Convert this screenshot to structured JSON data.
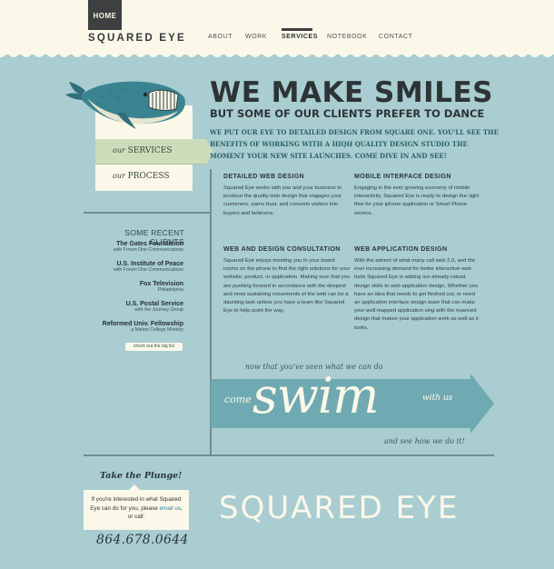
{
  "header": {
    "home_label": "HOME",
    "logo_text": "SQUARED EYE",
    "nav": [
      {
        "label": "ABOUT"
      },
      {
        "label": "WORK"
      },
      {
        "label": "SERVICES"
      },
      {
        "label": "NOTEBOOK"
      },
      {
        "label": "CONTACT"
      }
    ],
    "active_nav": "SERVICES"
  },
  "hero": {
    "title": "WE MAKE SMILES",
    "subtitle": "BUT SOME OF OUR CLIENTS PREFER TO DANCE",
    "intro": "WE PUT OUR EYE TO DETAILED DESIGN FROM SQUARE ONE. YOU'LL SEE THE BENEFITS OF WORKING WITH A HIQH QUALITY DESIGN STUDIO THE MOMENT YOUR NEW SITE LAUNCHES. COME DIVE IN AND SEE!"
  },
  "side_nav": {
    "services_prefix": "our",
    "services_label": "SERVICES",
    "process_prefix": "our",
    "process_label": "PROCESS"
  },
  "clients": {
    "title": "SOME RECENT CLIENTS",
    "items": [
      {
        "name": "The Gates Foundation",
        "sub": "with Forum One Communications"
      },
      {
        "name": "U.S. Institute of Peace",
        "sub": "with Forum One Communications"
      },
      {
        "name": "Fox Television",
        "sub": "Philadelphia"
      },
      {
        "name": "U.S. Postal Service",
        "sub": "with the Journey Group"
      },
      {
        "name": "Reformed Univ. Fellowship",
        "sub": "a Nation College Ministry"
      }
    ],
    "big_list_link": "check out the big list"
  },
  "services": [
    {
      "heading": "DETAILED WEB DESIGN",
      "body": "Squared Eye works with you and your business to produce the quality web design that engages your customers, earns trust, and converts visitors into buyers and believers."
    },
    {
      "heading": "MOBILE INTERFACE DESIGN",
      "body": "Engaging in the ever growing economy of mobile interactivity, Squared Eye is ready to design the right flow for your iphone application or Smart Phone service."
    },
    {
      "heading": "WEB AND DESIGN CONSULTATION",
      "body": "Squared Eye enjoys meeting you in your board rooms on the phone to find the right solutions for your website, product, or application. Making sure that you are pushing forward in accordance with the deepest and most sustaining movements of the web can be a daunting task unless you have a team like Squared Eye to help point the way."
    },
    {
      "heading": "WEB APPLICATION DESIGN",
      "body": "With the advent of what many call web 2.0, and the ever increasing demand for better interactive web tools Squared Eye is adding our already robust design skills to web application design. Whether you have an idea that needs to get fleshed out, or need an application interface design team that can make your well mapped application sing with the nuanced design that makes your application work as well as it looks."
    }
  ],
  "swim": {
    "intro": "now that you've seen what we can do",
    "come": "come",
    "word": "swim",
    "with": "with us",
    "outro": "and see how we do it!"
  },
  "contact": {
    "plunge_title": "Take the Plunge!",
    "text_before": "If you're interested in what Squared Eye can do for you, please",
    "email_link": "email us",
    "text_after": ", or call:",
    "phone": "864.678.0644"
  },
  "footer": {
    "logo_text": "SQUARED EYE"
  },
  "colors": {
    "background": "#a9cdd1",
    "cream": "#fbf8e9",
    "dark": "#3d3f40",
    "accent_blue": "#2b5e68",
    "banner": "#6faab2",
    "active_tab": "#cdddbb"
  }
}
